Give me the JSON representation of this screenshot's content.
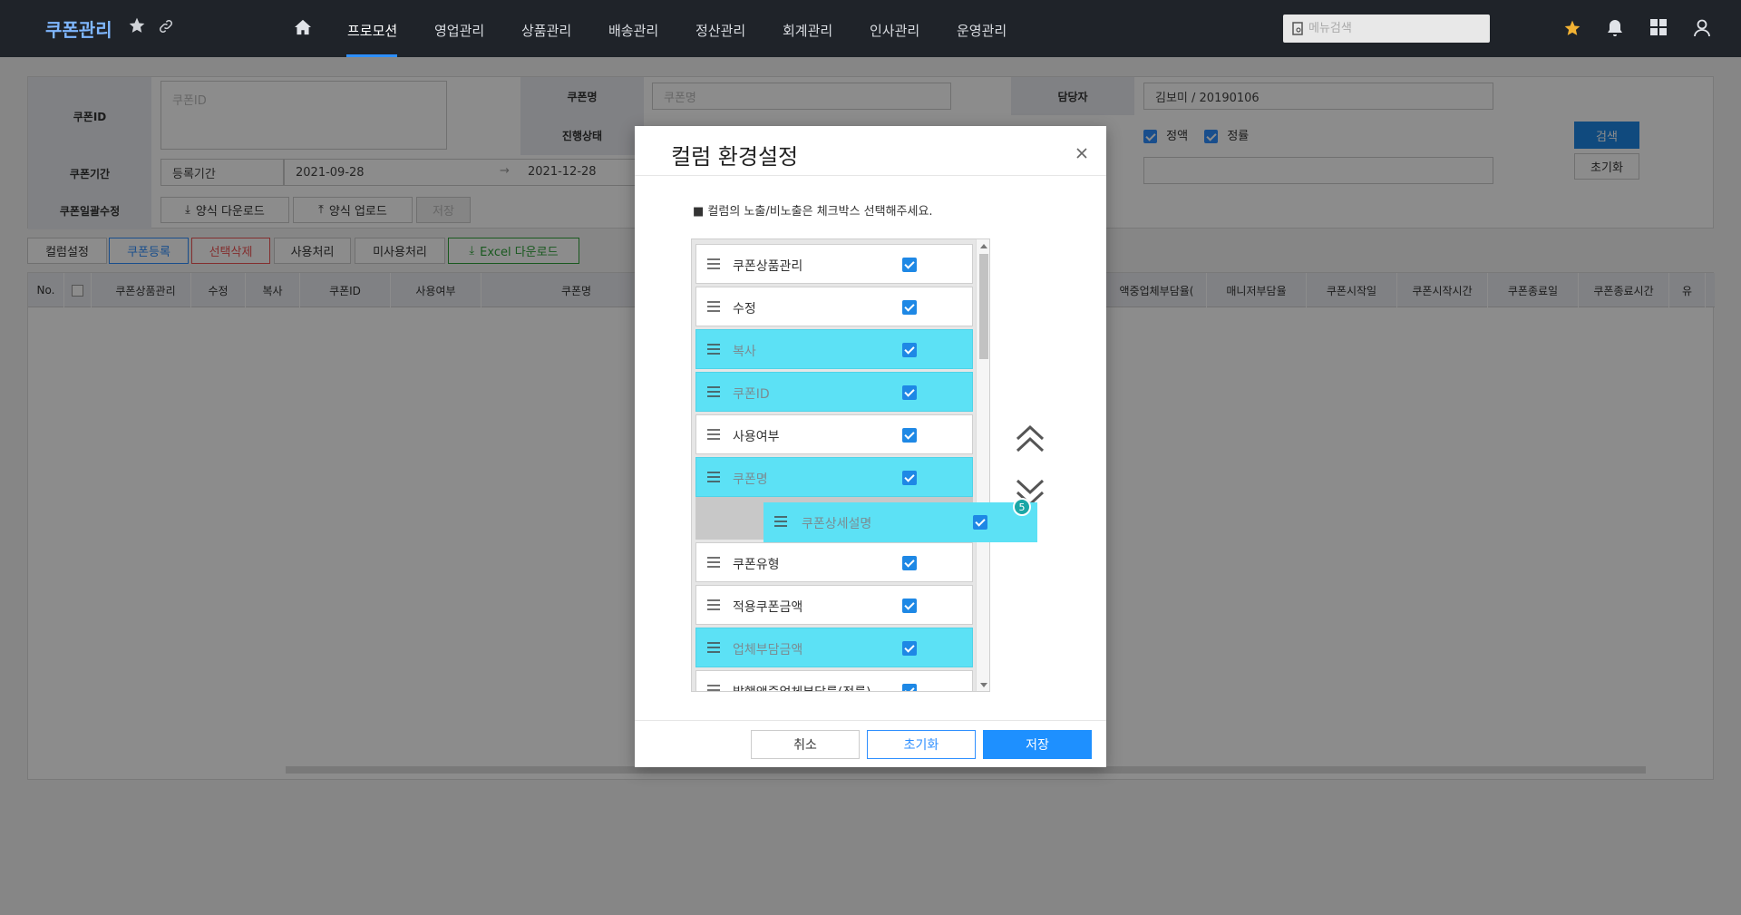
{
  "app": {
    "title": "쿠폰관리"
  },
  "nav": {
    "items": [
      "프로모션",
      "영업관리",
      "상품관리",
      "배송관리",
      "정산관리",
      "회계관리",
      "인사관리",
      "운영관리"
    ],
    "active": "프로모션"
  },
  "top_search": {
    "placeholder": "메뉴검색"
  },
  "search_form": {
    "coupon_id_label": "쿠폰ID",
    "coupon_id_placeholder": "쿠폰ID",
    "coupon_name_label": "쿠폰명",
    "coupon_name_placeholder": "쿠폰명",
    "manager_label": "담당자",
    "manager_value": "김보미 / 20190106",
    "status_label": "진행상태",
    "amount_type_1": "정액",
    "amount_type_2": "정률",
    "period_label": "쿠폰기간",
    "period_type": "등록기간",
    "date_start": "2021-09-28",
    "date_end": "2021-12-28",
    "bulk_label": "쿠폰일괄수정",
    "download_template": "양식 다운로드",
    "upload_template": "양식 업로드",
    "save": "저장",
    "search_button": "검색",
    "reset_button": "초기화"
  },
  "toolbar": {
    "column_settings": "컬럼설정",
    "coupon_register": "쿠폰등록",
    "delete_selected": "선택삭제",
    "mark_used": "사용처리",
    "mark_unused": "미사용처리",
    "excel_download": "Excel 다운로드"
  },
  "grid": {
    "headers": [
      "No.",
      "쿠폰상품관리",
      "수정",
      "복사",
      "쿠폰ID",
      "사용여부",
      "쿠폰명",
      "액중업체부담율(",
      "매니저부담율",
      "쿠폰시작일",
      "쿠폰시작시간",
      "쿠폰종료일",
      "쿠폰종료시간",
      "유"
    ]
  },
  "modal": {
    "title": "컬럼 환경설정",
    "notice": "■ 컬럼의 노출/비노출은 체크박스 선택해주세요.",
    "items": [
      {
        "label": "쿠폰상품관리",
        "checked": true,
        "highlighted": false
      },
      {
        "label": "수정",
        "checked": true,
        "highlighted": false
      },
      {
        "label": "복사",
        "checked": true,
        "highlighted": true
      },
      {
        "label": "쿠폰ID",
        "checked": true,
        "highlighted": true
      },
      {
        "label": "사용여부",
        "checked": true,
        "highlighted": false
      },
      {
        "label": "쿠폰명",
        "checked": true,
        "highlighted": true
      },
      {
        "label": "쿠폰유형",
        "checked": true,
        "highlighted": false
      },
      {
        "label": "적용쿠폰금액",
        "checked": true,
        "highlighted": false
      },
      {
        "label": "업체부담금액",
        "checked": true,
        "highlighted": true
      },
      {
        "label": "발행액중업체부담률(정률)",
        "checked": true,
        "highlighted": false
      }
    ],
    "dragging_item": {
      "label": "쿠폰상세설명",
      "checked": true,
      "count": "5"
    },
    "cancel": "취소",
    "reset": "초기화",
    "save": "저장"
  }
}
